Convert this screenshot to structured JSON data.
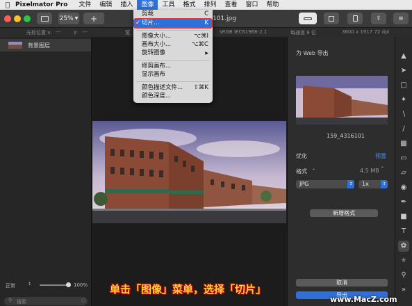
{
  "menubar": {
    "app_name": "Pixelmator Pro",
    "items": [
      "文件",
      "编辑",
      "插入",
      "图像",
      "工具",
      "格式",
      "排列",
      "查看",
      "窗口",
      "帮助"
    ],
    "active_item": "图像"
  },
  "toolbar": {
    "zoom": "25%",
    "add_label": "+",
    "doc_title_fragment": "101.jpg"
  },
  "infobar": {
    "cursor_label": "光标位置 x:",
    "cursor_x": "---",
    "cursor_y_label": "y:",
    "cursor_y": "---",
    "width_label": "宽",
    "color_profile": "sRGB IEC61966-2.1",
    "bit_depth": "每通道 8 位",
    "dimensions": "3600 x 1917 72 dpi"
  },
  "layers": {
    "items": [
      {
        "name": "背景图层"
      }
    ],
    "blend_mode": "正常",
    "opacity": "100%",
    "opacity_fraction": 1.0,
    "search_placeholder": "搜索"
  },
  "image_menu": {
    "items": [
      {
        "label": "剪裁",
        "shortcut": "C"
      },
      {
        "label": "切片...",
        "shortcut": "K",
        "checked": true,
        "highlighted": true
      },
      {
        "label": "图像大小...",
        "shortcut": "⌥⌘I"
      },
      {
        "label": "画布大小...",
        "shortcut": "⌥⌘C"
      },
      {
        "label": "旋转图像",
        "shortcut": "▶"
      },
      {
        "label": "修剪画布..."
      },
      {
        "label": "显示画布"
      },
      {
        "label": "颜色描述文件...",
        "shortcut": "⇧⌘K"
      },
      {
        "label": "颜色深度..."
      }
    ]
  },
  "export_panel": {
    "title": "为 Web 导出",
    "file_name": "159_4316101",
    "optimize_label": "优化",
    "preset_label": "预置",
    "format_label": "格式",
    "file_size": "4.5 MB",
    "format_value": "JPG",
    "scale_value": "1x",
    "add_format_button": "新增格式",
    "cancel_button": "取消",
    "export_button": "导出"
  },
  "caption": {
    "text": "单击「图像」菜单，选择「切片」",
    "watermark": "www.MacZ.com"
  },
  "colors": {
    "accent": "#2f6fd8",
    "highlight_box": "#e03b3b",
    "caption_text": "#ffd43b"
  },
  "tools": [
    "style-icon",
    "arrange-icon",
    "select-icon",
    "magic-icon",
    "eyedropper-icon",
    "brush-icon",
    "gradient-icon",
    "eraser-icon",
    "retouch-icon",
    "color-adjust-icon",
    "pen-icon",
    "shape-icon",
    "type-icon",
    "effects-icon",
    "star-icon",
    "zoom-icon",
    "more-icon"
  ]
}
